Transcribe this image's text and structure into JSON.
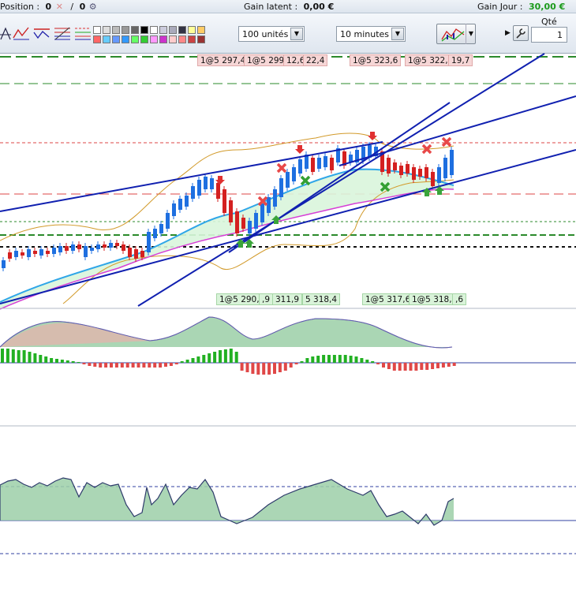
{
  "status_bar": {
    "position_label": "Position :",
    "position_value": "0",
    "orders_value": "0",
    "latent_label": "Gain latent :",
    "latent_value": "0,00 €",
    "day_label": "Gain Jour :",
    "day_value": "30,00 €"
  },
  "toolbar": {
    "units_select": "100 unités",
    "interval_select": "10 minutes",
    "qty_label": "Qté",
    "qty_value": "1"
  },
  "colors": {
    "up": "#1e6fe0",
    "down": "#d42020",
    "trendline": "#1020b0",
    "bollinger": "#d29a2a",
    "ma_fast": "#2fa6e8",
    "ma_slow": "#d63fd6",
    "hist_pos": "#22b022",
    "hist_neg": "#e04848",
    "osc_fill": "#9ccfa8"
  },
  "price_tags_top": [
    {
      "text": "1@5 297,4",
      "kind": "red"
    },
    {
      "text": "1@5 299,9",
      "kind": "red"
    },
    {
      "text": "12,6",
      "kind": "red"
    },
    {
      "text": "22,4",
      "kind": "red"
    },
    {
      "text": "1@5 323,6",
      "kind": "red"
    },
    {
      "text": "1@5 322,1",
      "kind": "red"
    },
    {
      "text": "19,7",
      "kind": "red"
    }
  ],
  "price_tags_bottom": [
    {
      "text": "1@5 290,4",
      "kind": "green"
    },
    {
      "text": ",9",
      "kind": "green"
    },
    {
      "text": "311,9",
      "kind": "green"
    },
    {
      "text": "5 318,4",
      "kind": "green"
    },
    {
      "text": "1@5 317,6",
      "kind": "green"
    },
    {
      "text": "1@5 318,9",
      "kind": "green"
    },
    {
      "text": ",6",
      "kind": "green"
    }
  ],
  "icons": [
    "close-icon",
    "gear-icon",
    "crosshair-icon",
    "trend-tool-icon",
    "channel-tool-icon",
    "fibonacci-icon",
    "indicators-icon",
    "wrench-icon",
    "dropdown-arrow-icon"
  ]
}
